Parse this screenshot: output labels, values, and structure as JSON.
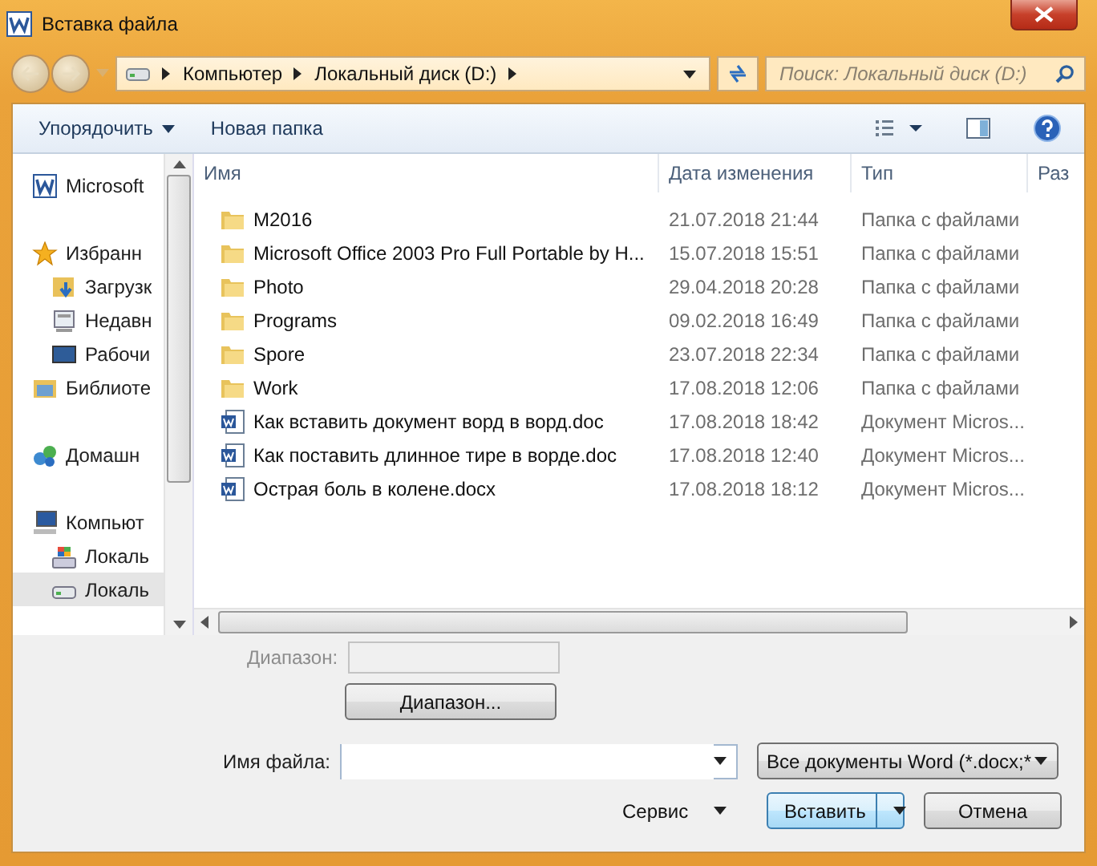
{
  "window": {
    "title": "Вставка файла"
  },
  "address_bar": {
    "path": [
      "Компьютер",
      "Локальный диск (D:)"
    ]
  },
  "search": {
    "placeholder": "Поиск: Локальный диск (D:)"
  },
  "toolbar": {
    "organize": "Упорядочить",
    "new_folder": "Новая папка"
  },
  "sidebar": {
    "items": [
      {
        "label": "Microsoft",
        "kind": "word",
        "selected": false
      },
      {
        "label": "Избранн",
        "kind": "star",
        "selected": false,
        "children": [
          {
            "label": "Загрузк",
            "kind": "downloads",
            "selected": false
          },
          {
            "label": "Недавн",
            "kind": "recent",
            "selected": false
          },
          {
            "label": "Рабочи",
            "kind": "desktop",
            "selected": false
          }
        ]
      },
      {
        "label": "Библиоте",
        "kind": "library",
        "selected": false
      },
      {
        "label": "Домашн",
        "kind": "homegroup",
        "selected": false
      },
      {
        "label": "Компьют",
        "kind": "computer",
        "selected": false,
        "children": [
          {
            "label": "Локаль",
            "kind": "windrive",
            "selected": false
          },
          {
            "label": "Локаль",
            "kind": "drive",
            "selected": true
          }
        ]
      }
    ]
  },
  "table": {
    "columns": [
      "Имя",
      "Дата изменения",
      "Тип",
      "Раз"
    ],
    "rows": [
      {
        "kind": "folder",
        "name": "M2016",
        "date": "21.07.2018 21:44",
        "type": "Папка с файлами"
      },
      {
        "kind": "folder",
        "name": "Microsoft Office 2003 Pro Full Portable by H...",
        "date": "15.07.2018 15:51",
        "type": "Папка с файлами"
      },
      {
        "kind": "folder",
        "name": "Photo",
        "date": "29.04.2018 20:28",
        "type": "Папка с файлами"
      },
      {
        "kind": "folder",
        "name": "Programs",
        "date": "09.02.2018 16:49",
        "type": "Папка с файлами"
      },
      {
        "kind": "folder",
        "name": "Spore",
        "date": "23.07.2018 22:34",
        "type": "Папка с файлами"
      },
      {
        "kind": "folder",
        "name": "Work",
        "date": "17.08.2018 12:06",
        "type": "Папка с файлами"
      },
      {
        "kind": "doc",
        "name": "Как вставить документ ворд в ворд.doc",
        "date": "17.08.2018 18:42",
        "type": "Документ Micros..."
      },
      {
        "kind": "doc",
        "name": "Как поставить длинное тире в ворде.doc",
        "date": "17.08.2018 12:40",
        "type": "Документ Micros..."
      },
      {
        "kind": "doc",
        "name": "Острая боль в колене.docx",
        "date": "17.08.2018 18:12",
        "type": "Документ Micros..."
      }
    ]
  },
  "range": {
    "label": "Диапазон:",
    "disabled": true,
    "button": "Диапазон..."
  },
  "file_name": {
    "label": "Имя файла:"
  },
  "file_type": {
    "value": "Все документы Word (*.docx;*"
  },
  "buttons": {
    "tools": "Сервис",
    "insert": "Вставить",
    "cancel": "Отмена"
  }
}
